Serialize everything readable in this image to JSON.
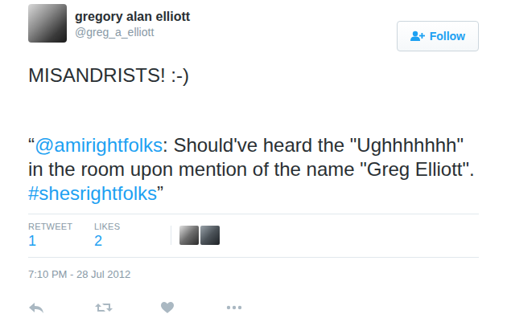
{
  "user": {
    "name": "gregory alan elliott",
    "handle": "@greg_a_elliott"
  },
  "follow_button": {
    "label": "Follow"
  },
  "tweet": {
    "paragraphs": [
      {
        "segments": [
          {
            "text": "MISANDRISTS! :-)",
            "kind": "text"
          }
        ]
      },
      {
        "segments": [
          {
            "text": "“",
            "kind": "text"
          },
          {
            "text": "@amirightfolks",
            "kind": "mention"
          },
          {
            "text": ": Should've heard the \"Ughhhhhhh\" in the room upon mention of the name \"Greg Elliott\". ",
            "kind": "text"
          },
          {
            "text": "#shesrightfolks",
            "kind": "hashtag"
          },
          {
            "text": "”",
            "kind": "text"
          }
        ]
      }
    ]
  },
  "stats": [
    {
      "label": "RETWEET",
      "count": "1"
    },
    {
      "label": "LIKES",
      "count": "2"
    }
  ],
  "timestamp": "7:10 PM - 28 Jul 2012"
}
